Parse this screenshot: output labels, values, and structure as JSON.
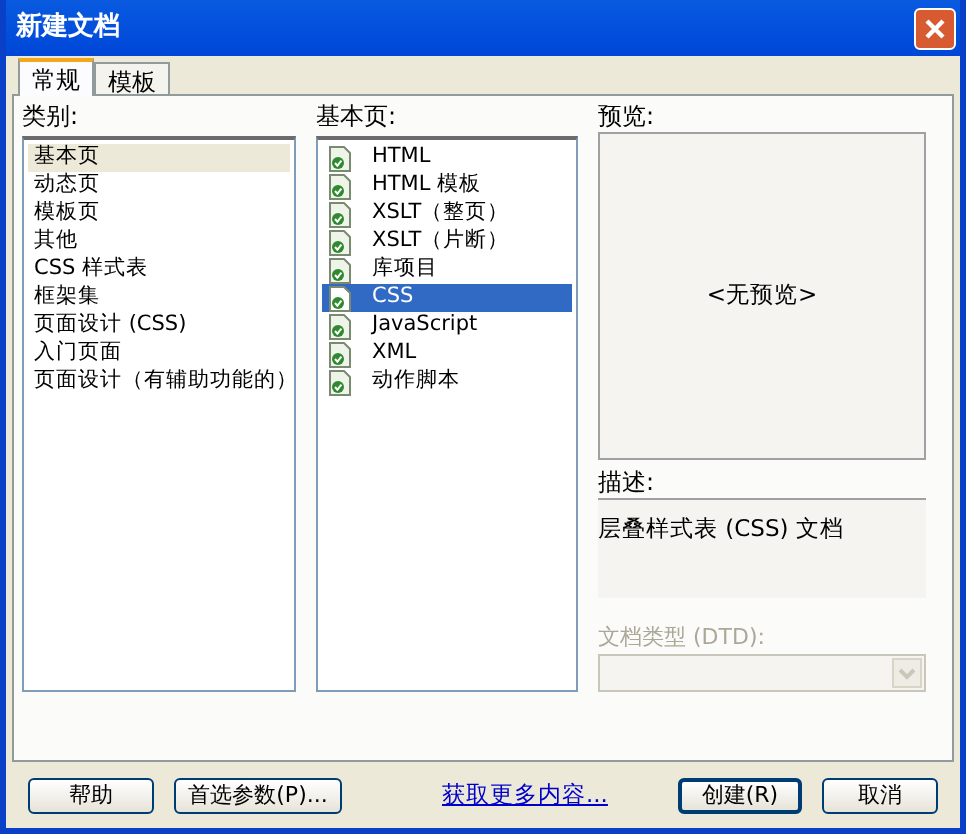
{
  "window": {
    "title": "新建文档"
  },
  "tabs": [
    {
      "label": "常规",
      "selected": true
    },
    {
      "label": "模板",
      "selected": false
    }
  ],
  "category": {
    "label": "类别:",
    "items": [
      {
        "label": "基本页",
        "selected": true
      },
      {
        "label": "动态页",
        "selected": false
      },
      {
        "label": "模板页",
        "selected": false
      },
      {
        "label": "其他",
        "selected": false
      },
      {
        "label": "CSS 样式表",
        "selected": false
      },
      {
        "label": "框架集",
        "selected": false
      },
      {
        "label": "页面设计 (CSS)",
        "selected": false
      },
      {
        "label": "入门页面",
        "selected": false
      },
      {
        "label": "页面设计（有辅助功能的）",
        "selected": false
      }
    ]
  },
  "pages": {
    "label": "基本页:",
    "items": [
      {
        "label": "HTML",
        "selected": false
      },
      {
        "label": "HTML 模板",
        "selected": false
      },
      {
        "label": "XSLT（整页）",
        "selected": false
      },
      {
        "label": "XSLT（片断）",
        "selected": false
      },
      {
        "label": "库项目",
        "selected": false
      },
      {
        "label": "CSS",
        "selected": true
      },
      {
        "label": "JavaScript",
        "selected": false
      },
      {
        "label": "XML",
        "selected": false
      },
      {
        "label": "动作脚本",
        "selected": false
      }
    ]
  },
  "preview": {
    "label": "预览:",
    "text": "<无预览>"
  },
  "description": {
    "label": "描述:",
    "text": "层叠样式表 (CSS) 文档"
  },
  "dtd": {
    "label": "文档类型 (DTD):",
    "disabled": true
  },
  "buttons": {
    "help": "帮助",
    "preferences": "首选参数(P)...",
    "more": "获取更多内容...",
    "create": "创建(R)",
    "cancel": "取消"
  }
}
